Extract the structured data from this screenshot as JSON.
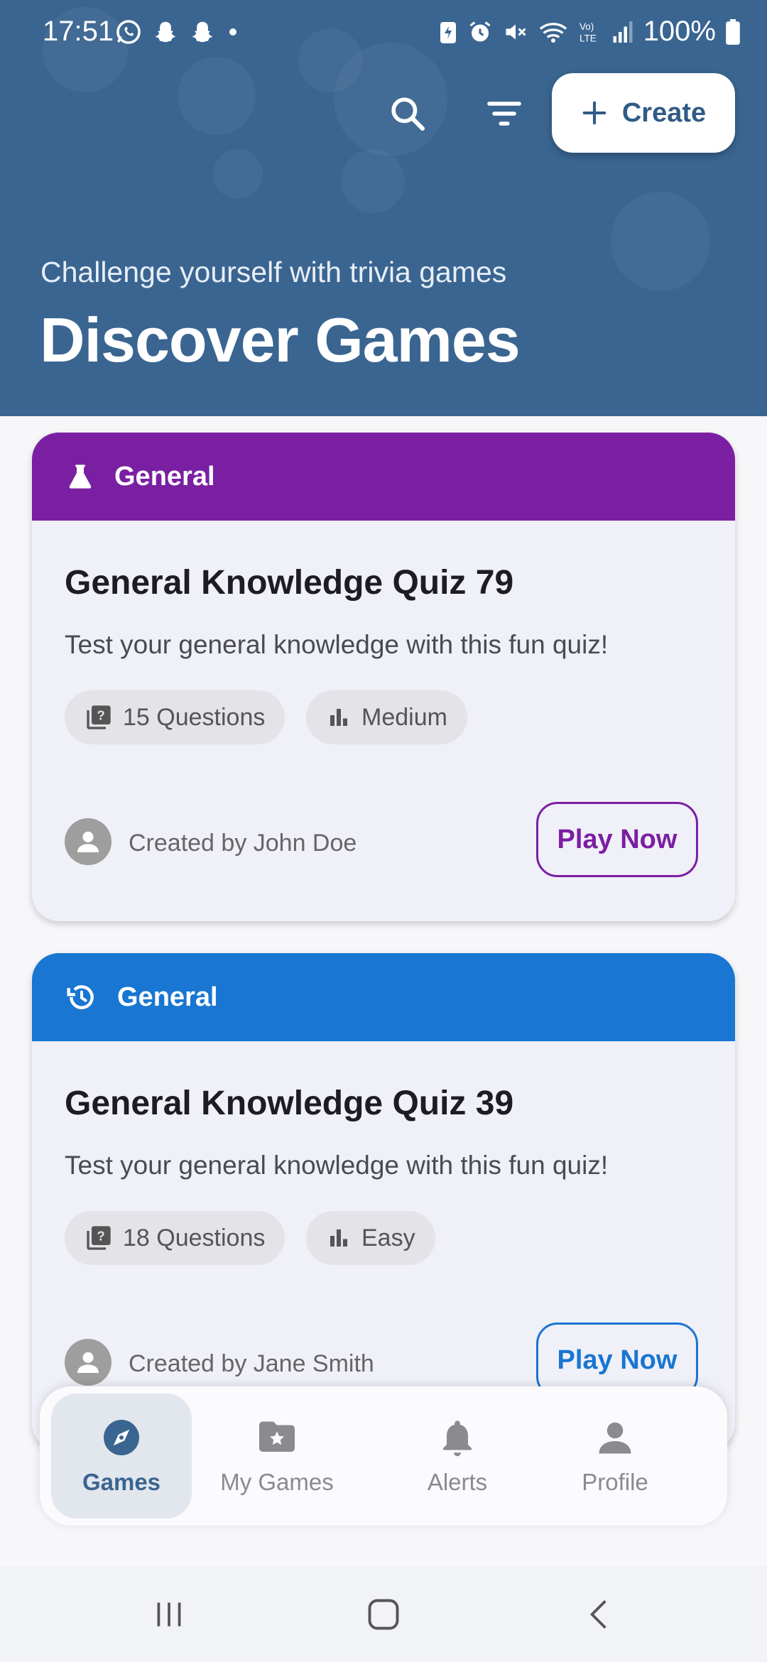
{
  "status_bar": {
    "time": "17:51",
    "battery": "100%",
    "left_icons": [
      "whatsapp-icon",
      "snapchat-icon",
      "snapchat-icon",
      "dot-icon"
    ],
    "right_icons": [
      "battery-saver-icon",
      "alarm-icon",
      "mute-icon",
      "wifi-icon",
      "volte-icon",
      "signal-icon",
      "battery-icon"
    ]
  },
  "toolbar": {
    "search_icon": "search-icon",
    "filter_icon": "filter-icon",
    "create_label": "Create"
  },
  "header": {
    "subtitle": "Challenge yourself with trivia games",
    "title": "Discover Games",
    "background_color": "#3a6591"
  },
  "games": [
    {
      "category": "General",
      "category_icon": "flask-icon",
      "accent_color": "#7b1fa2",
      "title": "General Knowledge Quiz 79",
      "description": "Test your general knowledge with this fun quiz!",
      "questions": "15 Questions",
      "difficulty": "Medium",
      "creator": "Created by John Doe",
      "play_label": "Play Now"
    },
    {
      "category": "General",
      "category_icon": "history-icon",
      "accent_color": "#1976d2",
      "title": "General Knowledge Quiz 39",
      "description": "Test your general knowledge with this fun quiz!",
      "questions": "18 Questions",
      "difficulty": "Easy",
      "creator": "Created by Jane Smith",
      "play_label": "Play Now"
    }
  ],
  "bottom_nav": {
    "items": [
      {
        "label": "Games",
        "icon": "compass-icon",
        "active": true
      },
      {
        "label": "My Games",
        "icon": "folder-star-icon",
        "active": false
      },
      {
        "label": "Alerts",
        "icon": "bell-icon",
        "active": false
      },
      {
        "label": "Profile",
        "icon": "person-icon",
        "active": false
      }
    ]
  },
  "system_nav": [
    "recents-icon",
    "home-icon",
    "back-icon"
  ]
}
